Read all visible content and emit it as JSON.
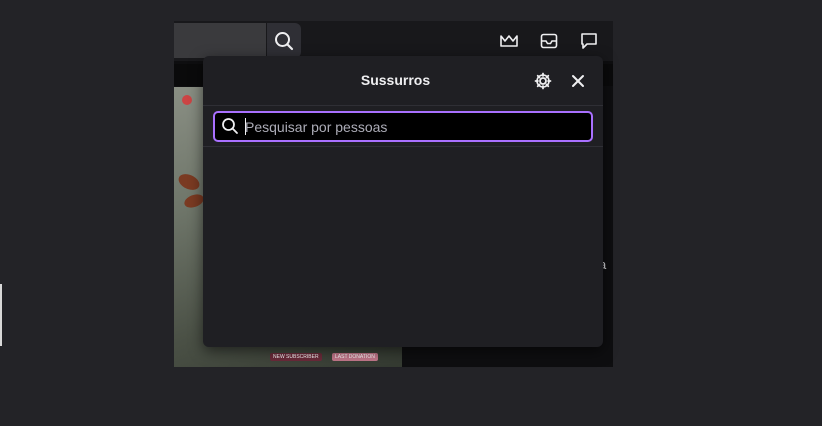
{
  "app": {
    "topbar_icons": [
      "crown-icon",
      "inbox-icon",
      "whispers-icon"
    ],
    "side_text": "a"
  },
  "whispers": {
    "title": "Sussurros",
    "search_placeholder": "Pesquisar por pessoas",
    "search_value": ""
  },
  "stream_overlay": {
    "badge_left": "NEW SUBSCRIBER",
    "badge_right": "LAST DONATION"
  },
  "colors": {
    "accent": "#a970ff",
    "panel_bg": "#1f1f23",
    "page_bg": "#232327"
  }
}
